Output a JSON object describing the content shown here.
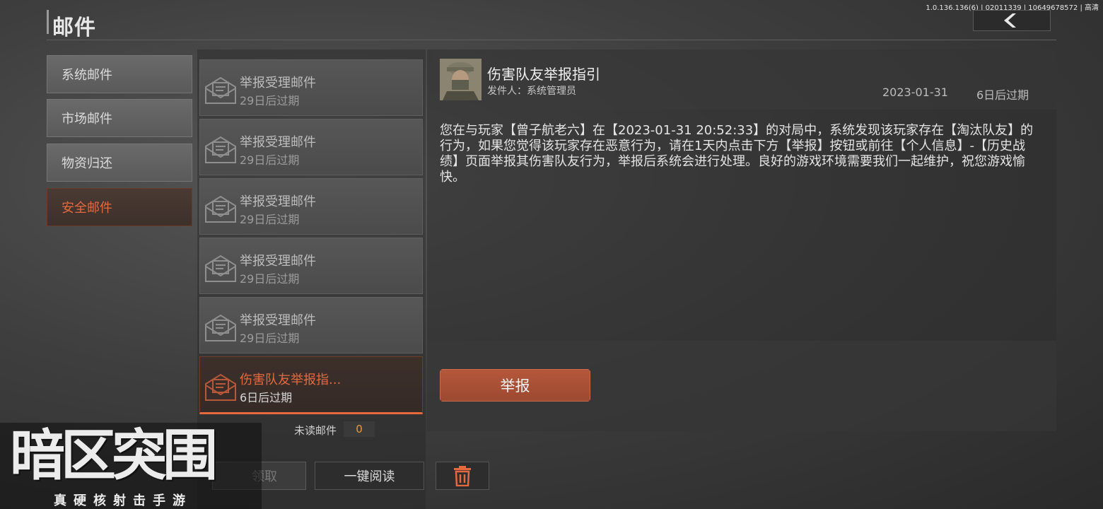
{
  "header": {
    "version": "1.0.136.136(6) | 02011339 | 10649678572 | 高清",
    "title": "邮件"
  },
  "categories": [
    {
      "label": "系统邮件",
      "active": false
    },
    {
      "label": "市场邮件",
      "active": false
    },
    {
      "label": "物资归还",
      "active": false
    },
    {
      "label": "安全邮件",
      "active": true
    }
  ],
  "mail_list": [
    {
      "title": "举报受理邮件",
      "expire": "29日后过期",
      "active": false
    },
    {
      "title": "举报受理邮件",
      "expire": "29日后过期",
      "active": false
    },
    {
      "title": "举报受理邮件",
      "expire": "29日后过期",
      "active": false
    },
    {
      "title": "举报受理邮件",
      "expire": "29日后过期",
      "active": false
    },
    {
      "title": "举报受理邮件",
      "expire": "29日后过期",
      "active": false
    },
    {
      "title": "伤害队友举报指...",
      "expire": "6日后过期",
      "active": true
    }
  ],
  "unread": {
    "label": "未读邮件",
    "count": "0"
  },
  "footer_buttons": {
    "claim": "领取",
    "read_all": "一键阅读"
  },
  "detail": {
    "title": "伤害队友举报指引",
    "sender_label": "发件人：",
    "sender_name": "系统管理员",
    "date": "2023-01-31",
    "expire": "6日后过期",
    "body": "您在与玩家【曾子航老六】在【2023-01-31 20:52:33】的对局中，系统发现该玩家存在【淘汰队友】的行为，如果您觉得该玩家存在恶意行为，请在1天内点击下方【举报】按钮或前往【个人信息】-【历史战绩】页面举报其伤害队友行为，举报后系统会进行处理。良好的游戏环境需要我们一起维护，祝您游戏愉快。",
    "report_button": "举报"
  },
  "logo": {
    "main": "暗区突围",
    "sub": "真硬核射击手游"
  },
  "colors": {
    "accent": "#e4693f",
    "report_button": "#b5573a",
    "unread_count": "#e89a3a"
  },
  "icons": [
    "back-arrow-icon",
    "mail-open-icon",
    "trash-icon"
  ]
}
